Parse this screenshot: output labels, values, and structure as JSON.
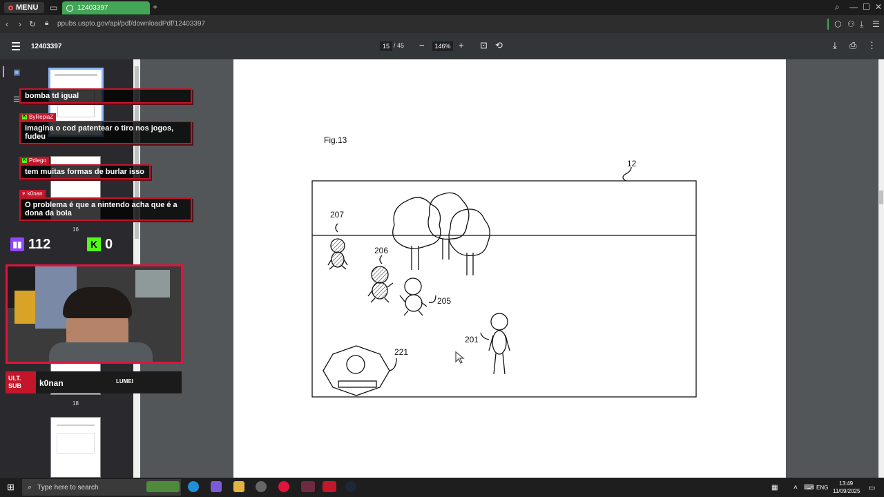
{
  "browser": {
    "menu_label": "MENU",
    "tab_title": "12403397",
    "new_tab": "+",
    "url": "ppubs.uspto.gov/api/pdf/downloadPdf/12403397"
  },
  "pdf_viewer": {
    "doc_title": "12403397",
    "current_page": "15",
    "total_pages": "/ 45",
    "zoom": "146%",
    "thumb_labels": [
      "16",
      "18"
    ]
  },
  "figure": {
    "title": "Fig.13",
    "labels": [
      "12",
      "207",
      "206",
      "205",
      "221",
      "201"
    ]
  },
  "stream_overlay": {
    "chat": [
      {
        "user": "",
        "text": "bomba td igual"
      },
      {
        "user": "ByRepiaZ",
        "text": "imagina o cod patentear o tiro nos jogos, fudeu"
      },
      {
        "user": "Pdiego",
        "text": "tem muitas formas de burlar isso"
      },
      {
        "user": "k0nan",
        "text": "O problema é que a nintendo acha que é a dona da bola"
      }
    ],
    "twitch_count": "112",
    "kick_count": "0",
    "streamer_name": "k0nan",
    "badge_text": "ULT. SUB",
    "sponsor_text": "LUMEI"
  },
  "taskbar": {
    "search_placeholder": "Type here to search",
    "language": "ENG",
    "time": "13:49",
    "date": "11/09/2025"
  }
}
